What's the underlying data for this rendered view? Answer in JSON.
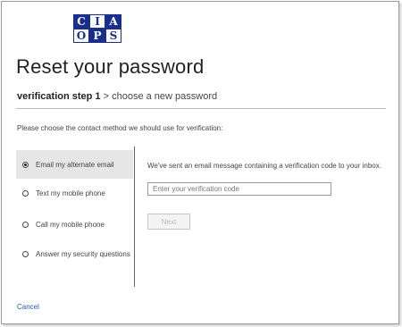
{
  "logo": {
    "letters": [
      "C",
      "I",
      "A",
      "O",
      "P",
      "S"
    ]
  },
  "header": {
    "title": "Reset your password"
  },
  "steps": {
    "current": "verification step 1",
    "separator": " > ",
    "next": "choose a new password"
  },
  "instruction": "Please choose the contact method we should use for verification:",
  "methods": [
    {
      "label": "Email my alternate email",
      "selected": true
    },
    {
      "label": "Text my mobile phone",
      "selected": false
    },
    {
      "label": "Call my mobile phone",
      "selected": false
    },
    {
      "label": "Answer my security questions",
      "selected": false
    }
  ],
  "detail": {
    "message": "We've sent an email message containing a verification code to your inbox.",
    "code_placeholder": "Enter your verification code",
    "code_value": "",
    "next_label": "Next"
  },
  "footer": {
    "cancel_label": "Cancel"
  },
  "colors": {
    "logo_blue": "#1a2e8c",
    "link": "#1e5aa8",
    "selected_bg": "#e6e6e6"
  }
}
